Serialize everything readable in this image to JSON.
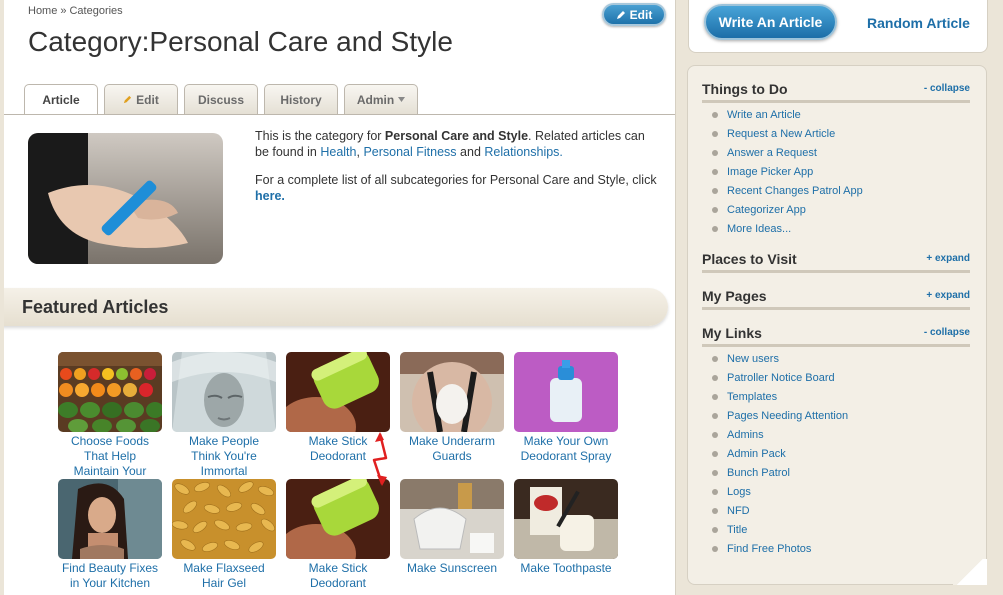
{
  "breadcrumb": {
    "home": "Home",
    "sep": "»",
    "current": "Categories"
  },
  "edit_button": {
    "label": "Edit"
  },
  "page_title": "Category:Personal Care and Style",
  "tabs": [
    {
      "label": "Article",
      "active": true
    },
    {
      "label": "Edit",
      "icon": "pencil-icon"
    },
    {
      "label": "Discuss"
    },
    {
      "label": "History"
    },
    {
      "label": "Admin",
      "icon": "dropdown-arrow-icon"
    }
  ],
  "intro": {
    "p1_pre": "This is the category for ",
    "p1_bold": "Personal Care and Style",
    "p1_mid": ". Related articles can be found in ",
    "link_health": "Health",
    "comma": ",",
    "link_fitness": "Personal Fitness",
    "and": " and ",
    "link_relationships": "Relationships.",
    "p2_pre": "For a complete list of all subcategories for Personal Care and Style, click ",
    "p2_link": "here."
  },
  "featured": {
    "title": "Featured Articles",
    "items": [
      {
        "caption": "Choose Foods That Help Maintain Your Beauty",
        "image": "fruit-stand"
      },
      {
        "caption": "Make People Think You're Immortal",
        "image": "veiled-face"
      },
      {
        "caption": "Make Stick Deodorant",
        "image": "green-deodorant"
      },
      {
        "caption": "Make Underarm Guards",
        "image": "underarm-guard"
      },
      {
        "caption": "Make Your Own Deodorant Spray",
        "image": "spray-bottle"
      },
      {
        "caption": "Find Beauty Fixes in Your Kitchen",
        "image": "woman-portrait"
      },
      {
        "caption": "Make Flaxseed Hair Gel",
        "image": "flaxseeds"
      },
      {
        "caption": "Make Stick Deodorant",
        "image": "green-deodorant"
      },
      {
        "caption": "Make Sunscreen",
        "image": "sunscreen-ingredients"
      },
      {
        "caption": "Make Toothpaste",
        "image": "toothpaste-ingredients"
      }
    ]
  },
  "sidebar": {
    "write_button": "Write An Article",
    "random_link": "Random Article",
    "things_to_do": {
      "title": "Things to Do",
      "toggle": "- collapse",
      "items": [
        "Write an Article",
        "Request a New Article",
        "Answer a Request",
        "Image Picker App",
        "Recent Changes Patrol App",
        "Categorizer App",
        "More Ideas..."
      ]
    },
    "places_to_visit": {
      "title": "Places to Visit",
      "toggle": "+ expand"
    },
    "my_pages": {
      "title": "My Pages",
      "toggle": "+ expand"
    },
    "my_links": {
      "title": "My Links",
      "toggle": "- collapse",
      "items": [
        "New users",
        "Patroller Notice Board",
        "Templates",
        "Pages Needing Attention",
        "Admins",
        "Admin Pack",
        "Bunch Patrol",
        "Logs",
        "NFD",
        "Title",
        "Find Free Photos"
      ]
    }
  },
  "colors": {
    "link": "#1e6fa8",
    "button": "#2a86c2",
    "sidebar_bg": "#f3efe6",
    "annotation": "#e02020"
  }
}
